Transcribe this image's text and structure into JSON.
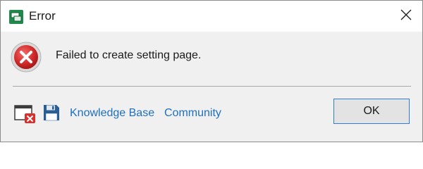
{
  "window": {
    "title": "Error",
    "app_icon": "app-dialog-icon",
    "close_icon": "close-icon"
  },
  "dialog": {
    "message": "Failed to create setting page.",
    "status_icon": "error-icon",
    "accent_color": "#2f7ed8",
    "error_color": "#c8202a"
  },
  "footer": {
    "details_icon": "window-error-icon",
    "save_icon": "save-icon",
    "links": {
      "knowledge_base": "Knowledge Base",
      "community": "Community"
    },
    "link_color": "#1e6fbf",
    "ok_label": "OK"
  }
}
